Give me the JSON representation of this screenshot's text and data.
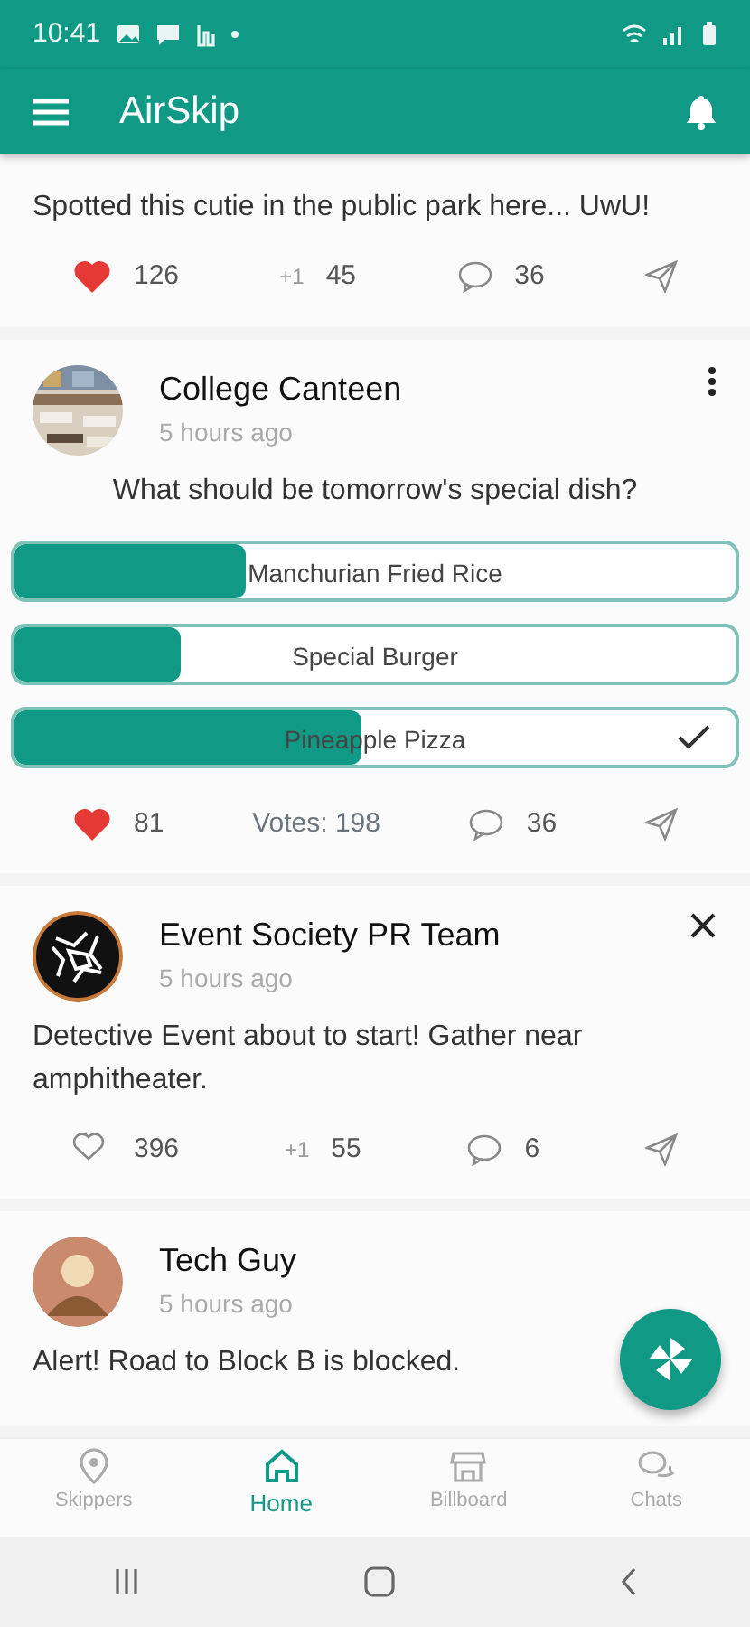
{
  "status_bar": {
    "time": "10:41"
  },
  "app_bar": {
    "title": "AirSkip"
  },
  "posts": [
    {
      "text": "Spotted this cutie in the public park here... UwU!",
      "likes": {
        "count": "126",
        "liked": true
      },
      "extra": {
        "kind": "plus_one",
        "label": "+1",
        "count": "45"
      },
      "comments": "36"
    },
    {
      "author": "College Canteen",
      "time": "5 hours ago",
      "text": "What should be tomorrow's special dish?",
      "poll": [
        {
          "label": "Manchurian Fried Rice",
          "level": 0.32,
          "selected": false
        },
        {
          "label": "Special Burger",
          "level": 0.23,
          "selected": false
        },
        {
          "label": "Pineapple Pizza",
          "level": 0.48,
          "selected": true
        }
      ],
      "likes": {
        "count": "81",
        "liked": true
      },
      "extra": {
        "kind": "votes",
        "label": "Votes: 198"
      },
      "comments": "36"
    },
    {
      "author": "Event Society PR Team",
      "time": "5 hours ago",
      "text": "Detective Event about to start! Gather near amphitheater.",
      "likes": {
        "count": "396",
        "liked": false
      },
      "extra": {
        "kind": "plus_one",
        "label": "+1",
        "count": "55"
      },
      "comments": "6"
    },
    {
      "author": "Tech Guy",
      "time": "5 hours ago",
      "text": "Alert! Road to Block B is blocked."
    }
  ],
  "bottom_nav": [
    {
      "label": "Skippers",
      "selected": false
    },
    {
      "label": "Home",
      "selected": true
    },
    {
      "label": "Billboard",
      "selected": false
    },
    {
      "label": "Chats",
      "selected": false
    }
  ]
}
